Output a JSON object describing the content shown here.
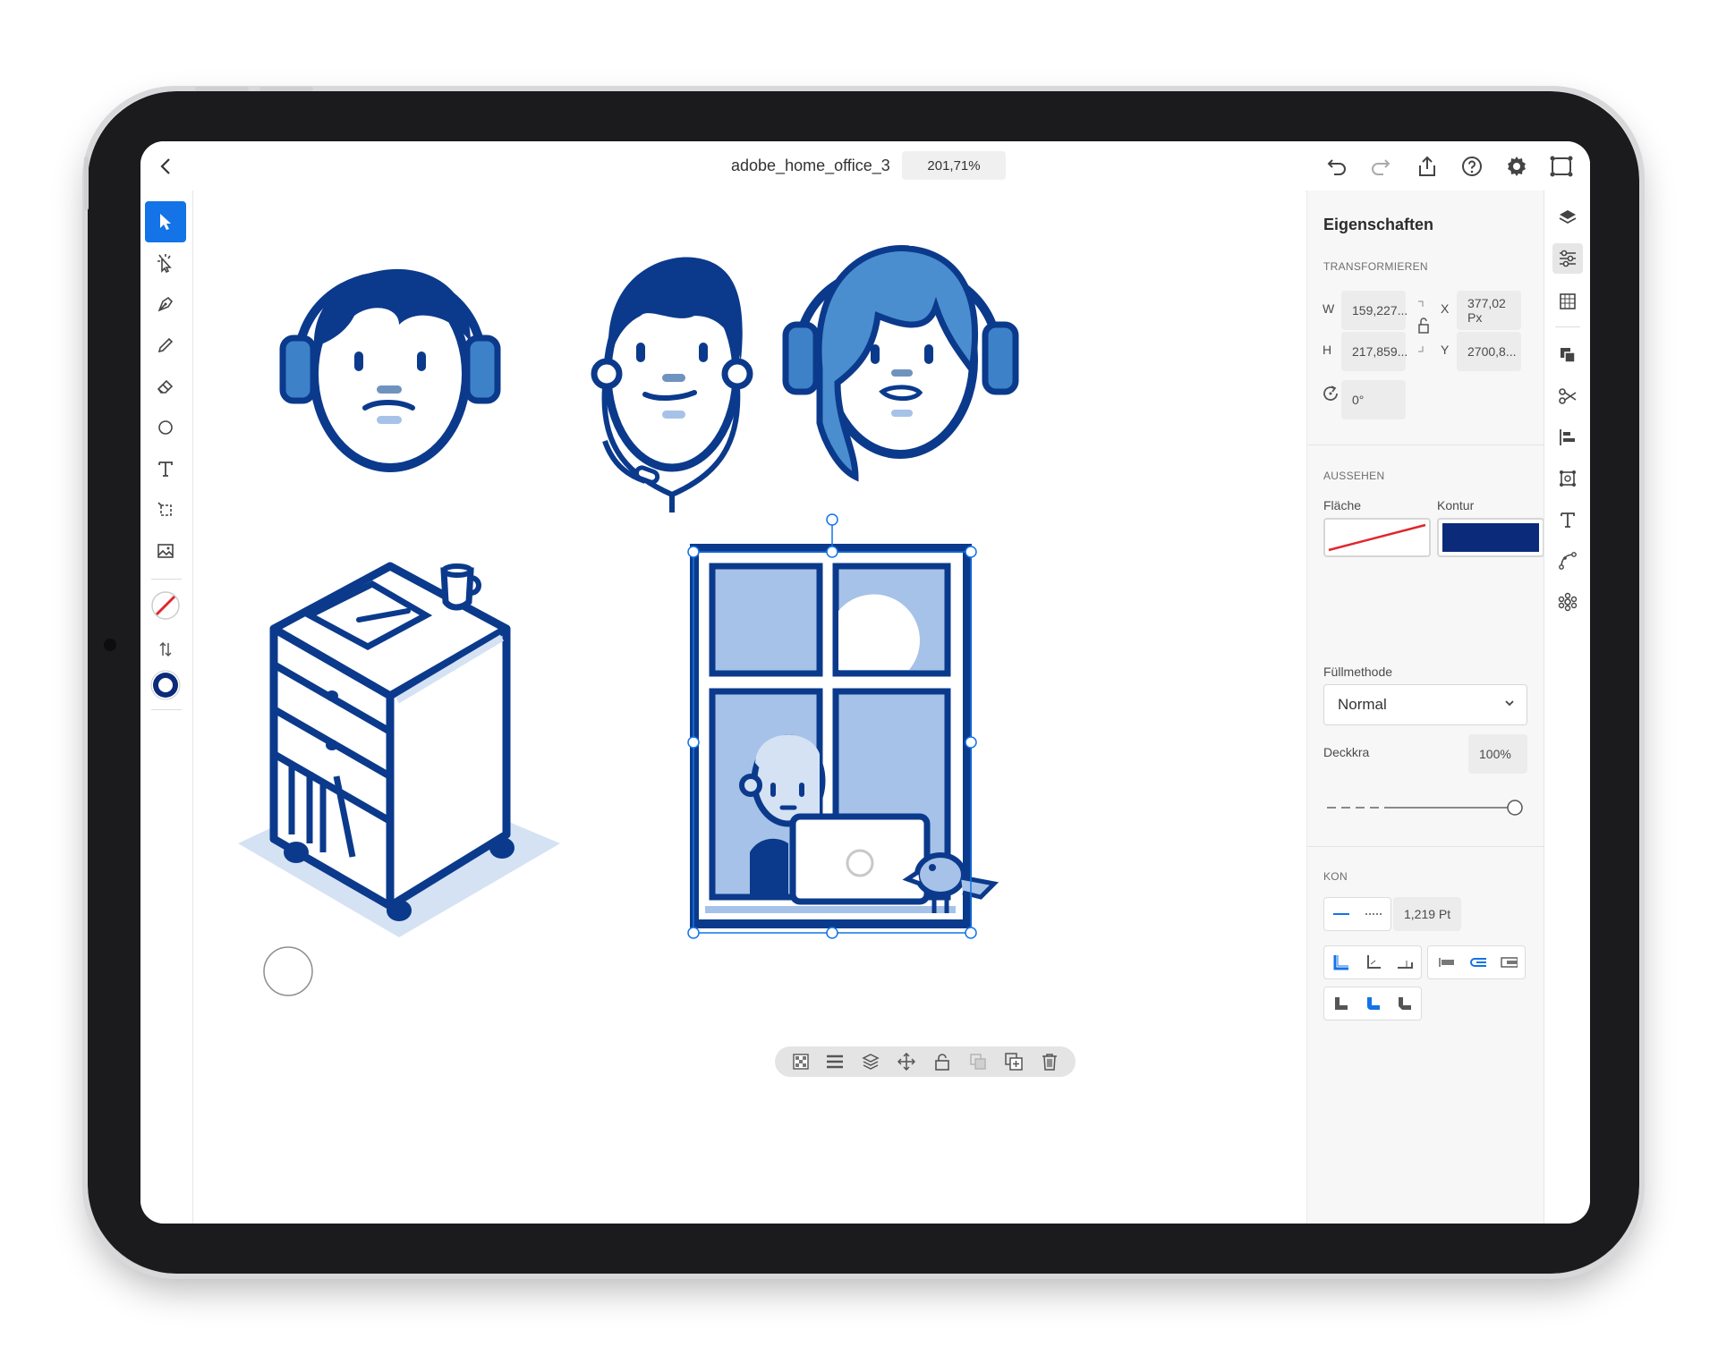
{
  "app": {
    "doc_title": "adobe_home_office_3",
    "zoom": "201,71%"
  },
  "topbar": {
    "icons": [
      "back-chevron-icon",
      "undo-icon",
      "redo-icon",
      "share-icon",
      "help-icon",
      "settings-icon",
      "cloud-sync-icon"
    ]
  },
  "toolbar": {
    "tools": [
      "selection-tool-icon",
      "direct-selection-tool-icon",
      "pen-tool-icon",
      "pencil-tool-icon",
      "eraser-tool-icon",
      "shape-tool-icon",
      "type-tool-icon",
      "crop-tool-icon",
      "place-image-icon",
      "fill-none-swatch-icon",
      "swap-fill-stroke-icon",
      "stroke-swatch-icon"
    ]
  },
  "properties": {
    "title": "Eigenschaften",
    "transform_section": "TRANSFORMIEREN",
    "w_label": "W",
    "w_value": "159,227...",
    "h_label": "H",
    "h_value": "217,859...",
    "x_label": "X",
    "x_value": "377,02 Px",
    "y_label": "Y",
    "y_value": "2700,8...",
    "rotation_value": "0°",
    "appearance_section": "AUSSEHEN",
    "fill_label": "Fläche",
    "stroke_label": "Kontur",
    "stroke_color": "#0b2b7a",
    "blend_label": "Füllmethode",
    "blend_value": "Normal",
    "opacity_label": "Deckkra",
    "opacity_value": "100%",
    "opacity_level": 1.0,
    "contour_section": "KON",
    "stroke_weight": "1,219 Pt"
  },
  "context_bar": {
    "icons": [
      "transparency-grid-icon",
      "align-menu-icon",
      "arrange-layers-icon",
      "move-icon",
      "lock-icon",
      "duplicate-disabled-icon",
      "duplicate-icon",
      "trash-icon"
    ]
  },
  "right_rail": {
    "icons": [
      "layers-icon",
      "properties-icon",
      "grid-icon",
      "pathfinder-icon",
      "scissors-icon",
      "align-icon",
      "transform-icon",
      "type-panel-icon",
      "path-icon",
      "repeat-icon"
    ]
  },
  "colors": {
    "navy": "#0b3a8c",
    "light_blue": "#a6c2e8",
    "mid_blue": "#4a8ecf",
    "accent": "#1473e6"
  }
}
